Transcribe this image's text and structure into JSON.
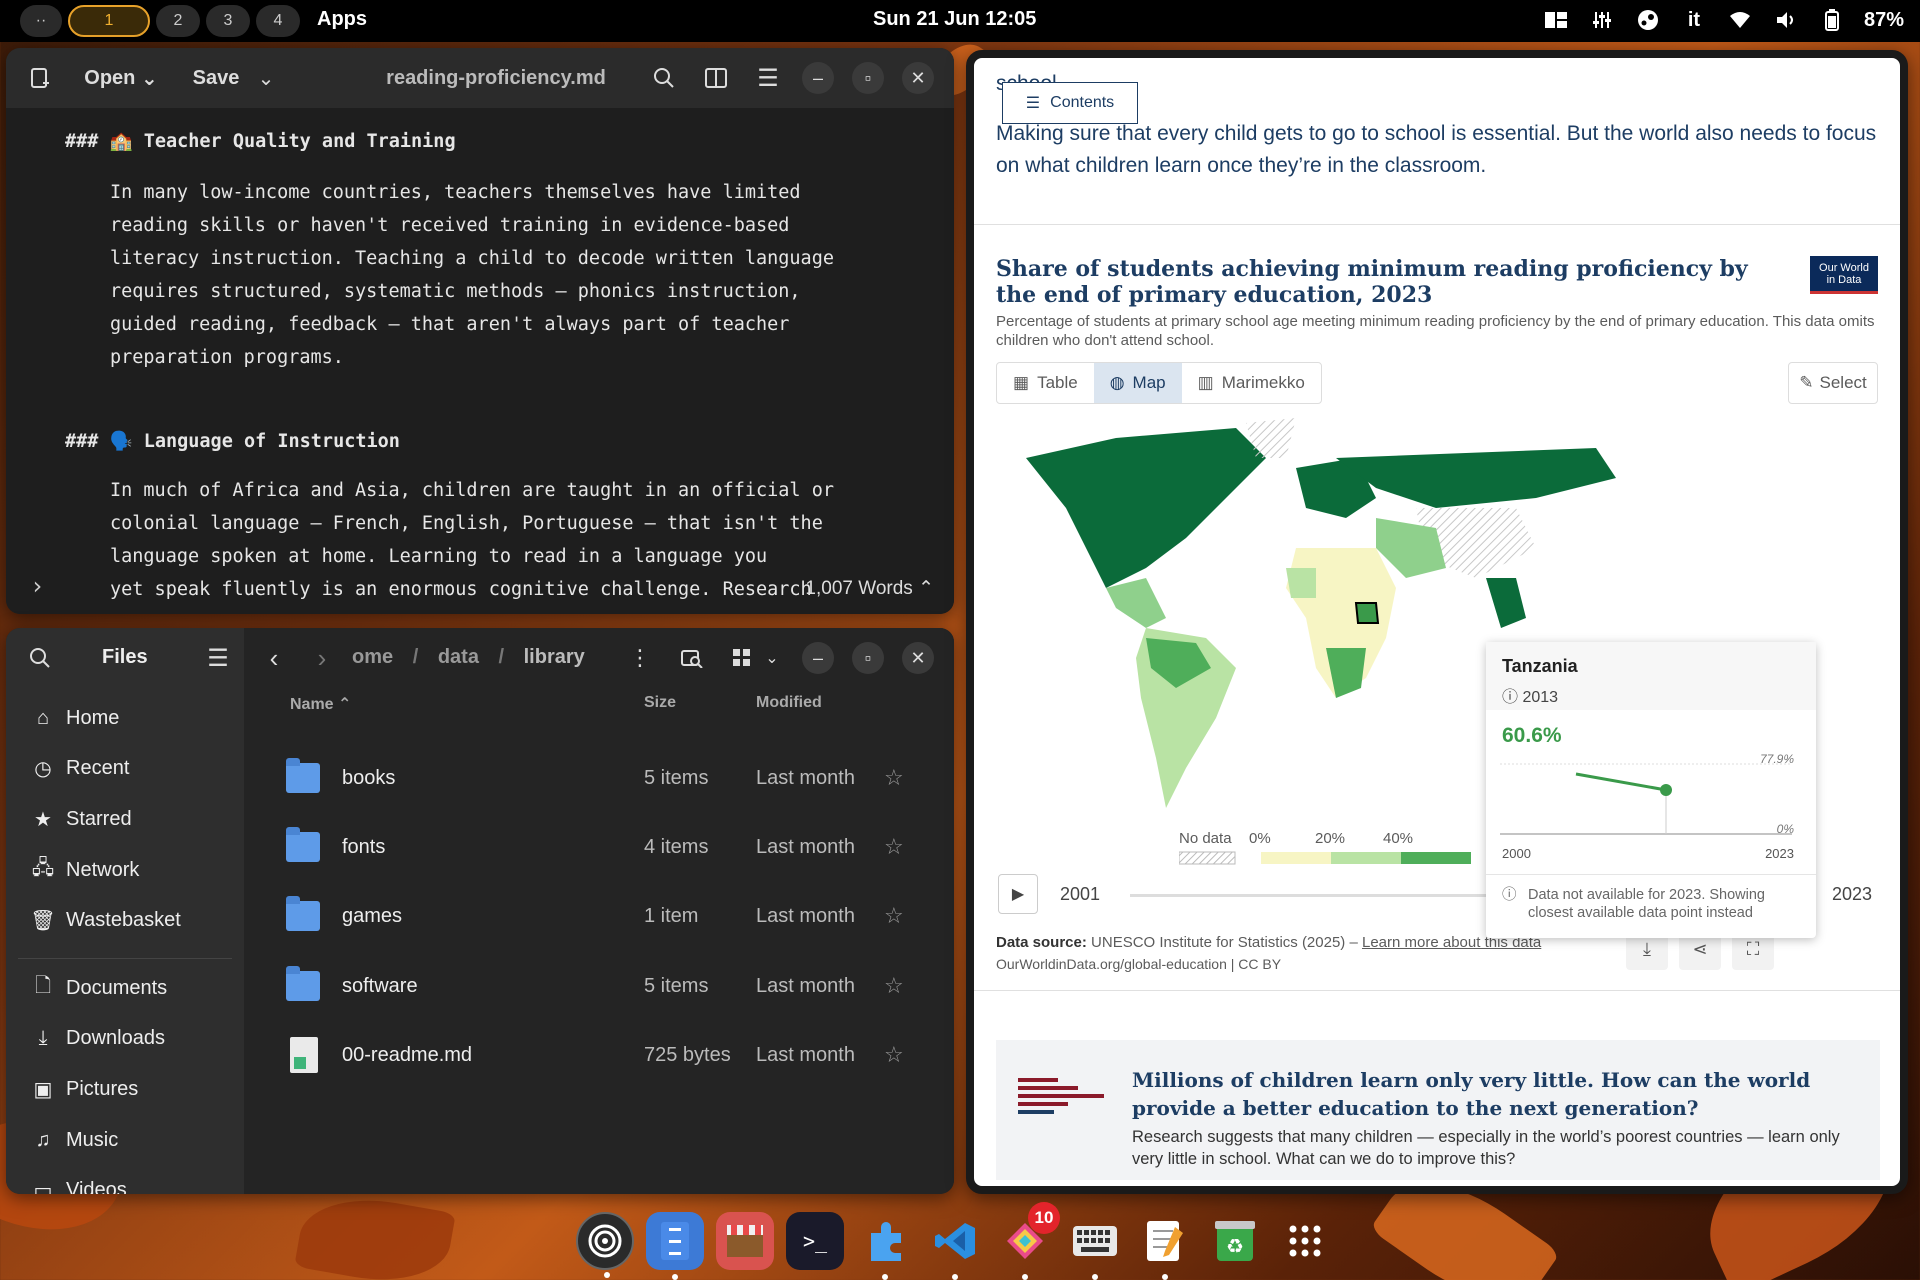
{
  "topbar": {
    "overview_label": "··",
    "workspaces": [
      "1",
      "2",
      "3",
      "4"
    ],
    "apps_label": "Apps",
    "clock": "Sun 21 Jun  12:05",
    "lang": "it",
    "battery": "87%"
  },
  "editor": {
    "open_label": "Open",
    "save_label": "Save",
    "title": "reading-proficiency.md",
    "heading1": "### 🏫 Teacher Quality and Training",
    "para1": "In many low-income countries, teachers themselves have limited\nreading skills or haven't received training in evidence-based\nliteracy instruction. Teaching a child to decode written language\nrequires structured, systematic methods — phonics instruction,\nguided reading, feedback — that aren't always part of teacher\npreparation programs.",
    "heading2": "### 🗣️ Language of Instruction",
    "para2": "In much of Africa and Asia, children are taught in an official or\ncolonial language — French, English, Portuguese — that isn't the\nlanguage spoken at home. Learning to read in a language you\nyet speak fluently is an enormous cognitive challenge. Research",
    "word_count": "1,007 Words"
  },
  "files": {
    "title": "Files",
    "breadcrumb": [
      "ome",
      "data",
      "library"
    ],
    "sidebar": [
      {
        "label": "Home",
        "icon": "home-icon"
      },
      {
        "label": "Recent",
        "icon": "clock-icon"
      },
      {
        "label": "Starred",
        "icon": "star-icon"
      },
      {
        "label": "Network",
        "icon": "network-icon"
      },
      {
        "label": "Wastebasket",
        "icon": "trash-icon"
      },
      {
        "label": "Documents",
        "icon": "document-icon"
      },
      {
        "label": "Downloads",
        "icon": "download-icon"
      },
      {
        "label": "Pictures",
        "icon": "picture-icon"
      },
      {
        "label": "Music",
        "icon": "music-icon"
      },
      {
        "label": "Videos",
        "icon": "video-icon"
      }
    ],
    "columns": {
      "name": "Name",
      "size": "Size",
      "modified": "Modified"
    },
    "rows": [
      {
        "name": "books",
        "size": "5 items",
        "modified": "Last month",
        "type": "folder"
      },
      {
        "name": "fonts",
        "size": "4 items",
        "modified": "Last month",
        "type": "folder"
      },
      {
        "name": "games",
        "size": "1 item",
        "modified": "Last month",
        "type": "folder"
      },
      {
        "name": "software",
        "size": "5 items",
        "modified": "Last month",
        "type": "folder"
      },
      {
        "name": "00-readme.md",
        "size": "725 bytes",
        "modified": "Last month",
        "type": "file"
      }
    ]
  },
  "browser": {
    "scrolled_text": "school",
    "contents_label": "Contents",
    "intro": "Making sure that every child gets to go to school is essential. But the world also needs to focus on what children learn once they’re in the classroom.",
    "chart_title": "Share of students achieving minimum reading proficiency by the end of primary education, 2023",
    "logo_text": "Our World in Data",
    "chart_subtitle": "Percentage of students at primary school age meeting minimum reading proficiency by the end of primary education. This data omits children who don't attend school.",
    "tabs": [
      "Table",
      "Map",
      "Marimekko"
    ],
    "select_label": "Select",
    "legend": [
      "No data",
      "0%",
      "20%",
      "40%"
    ],
    "year_start": "2001",
    "year_end": "2023",
    "source_label": "Data source:",
    "source_text": "UNESCO Institute for Statistics (2025) – ",
    "source_link": "Learn more about this data",
    "url": "OurWorldinData.org/global-education | CC BY",
    "tooltip": {
      "country": "Tanzania",
      "year": "2013",
      "value": "60.6%",
      "max_label": "77.9%",
      "min_label": "0%",
      "x_start": "2000",
      "x_end": "2023",
      "note": "Data not available for 2023. Showing closest available data point instead"
    },
    "related_title": "Millions of children learn only very little. How can the world provide a better education to the next generation?",
    "related_desc": "Research suggests that many children — especially in the world’s poorest countries — learn only very little in school. What can we do to improve this?"
  },
  "dock": {
    "badge_count": "10",
    "apps": [
      "podcast-icon",
      "files-icon",
      "store-icon",
      "terminal-icon",
      "extensions-icon",
      "vscode-icon",
      "design-icon",
      "keyboard-icon",
      "text-editor-icon",
      "recycle-icon",
      "app-grid-icon"
    ]
  },
  "colors": {
    "accent": "#e8a22a",
    "owid_blue": "#1d3d63",
    "map_dark": "#0b6b3a",
    "map_light": "#f7f5c4"
  }
}
